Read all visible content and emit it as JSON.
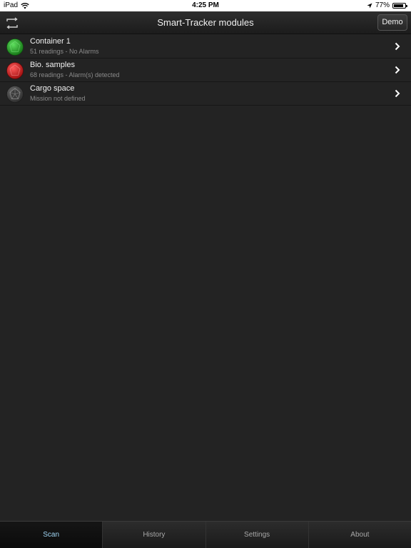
{
  "status_bar": {
    "device": "iPad",
    "time": "4:25 PM",
    "battery": "77%",
    "battery_level": 0.77
  },
  "nav": {
    "title": "Smart-Tracker modules",
    "demo_label": "Demo"
  },
  "modules": [
    {
      "name": "Container 1",
      "subtitle": "51 readings - No Alarms",
      "status_color": "#22a322"
    },
    {
      "name": "Bio. samples",
      "subtitle": "68 readings - Alarm(s) detected",
      "status_color": "#e01818"
    },
    {
      "name": "Cargo space",
      "subtitle": "Mission not defined",
      "status_color": "#5a5a5a"
    }
  ],
  "tabs": [
    {
      "label": "Scan",
      "active": true
    },
    {
      "label": "History",
      "active": false
    },
    {
      "label": "Settings",
      "active": false
    },
    {
      "label": "About",
      "active": false
    }
  ],
  "colors": {
    "background": "#232323",
    "active_tab_text": "#9fd4f2"
  }
}
